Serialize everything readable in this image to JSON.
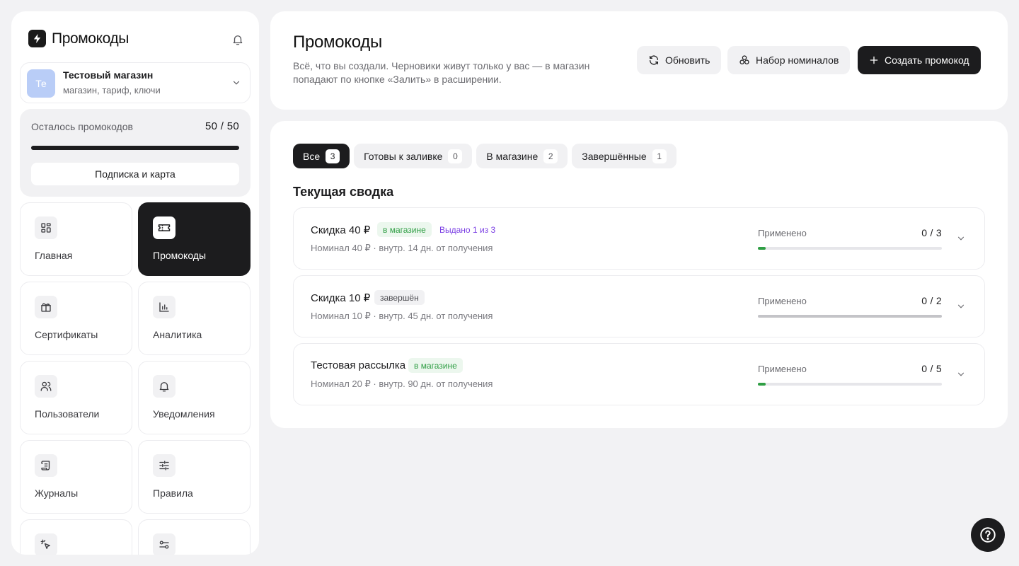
{
  "brand": {
    "title": "Промокоды"
  },
  "store": {
    "avatar": "Те",
    "name": "Тестовый магазин",
    "subtitle": "магазин, тариф, ключи"
  },
  "quota": {
    "label": "Осталось промокодов",
    "value": "50 / 50",
    "fill_fraction": 1.0,
    "subscription_label": "Подписка и карта"
  },
  "nav": [
    {
      "label": "Главная",
      "icon": "grid-icon",
      "active": false
    },
    {
      "label": "Промокоды",
      "icon": "ticket-icon",
      "active": true
    },
    {
      "label": "Сертификаты",
      "icon": "gift-icon",
      "active": false
    },
    {
      "label": "Аналитика",
      "icon": "bar-chart-icon",
      "active": false
    },
    {
      "label": "Пользователи",
      "icon": "users-icon",
      "active": false
    },
    {
      "label": "Уведомления",
      "icon": "bell-icon",
      "active": false
    },
    {
      "label": "Журналы",
      "icon": "scroll-icon",
      "active": false
    },
    {
      "label": "Правила",
      "icon": "sliders-icon",
      "active": false
    },
    {
      "label": "",
      "icon": "pointer-click-icon",
      "active": false
    },
    {
      "label": "",
      "icon": "settings-toggles-icon",
      "active": false
    }
  ],
  "header": {
    "title": "Промокоды",
    "description": "Всё, что вы создали. Черновики живут только у вас — в магазин попадают по кнопке «Залить» в расширении.",
    "refresh_label": "Обновить",
    "denominations_label": "Набор номиналов",
    "create_label": "Создать промокод"
  },
  "tabs": [
    {
      "label": "Все",
      "count": "3",
      "active": true
    },
    {
      "label": "Готовы к заливке",
      "count": "0",
      "active": false
    },
    {
      "label": "В магазине",
      "count": "2",
      "active": false
    },
    {
      "label": "Завершённые",
      "count": "1",
      "active": false
    }
  ],
  "section_title": "Текущая сводка",
  "promos": [
    {
      "name": "Скидка 40 ₽",
      "badge": "в магазине",
      "badge_type": "green",
      "issued": "Выдано 1 из 3",
      "meta": "Номинал 40 ₽ · внутр. 14 дн. от получения",
      "applied_label": "Применено",
      "applied_value": "0 / 3",
      "applied_fraction": 0.0
    },
    {
      "name": "Скидка 10 ₽",
      "badge": "завершён",
      "badge_type": "gray",
      "issued": "",
      "meta": "Номинал 10 ₽ · внутр. 45 дн. от получения",
      "applied_label": "Применено",
      "applied_value": "0 / 2",
      "applied_fraction": 0.0
    },
    {
      "name": "Тестовая рассылка",
      "badge": "в магазине",
      "badge_type": "green",
      "issued": "",
      "meta": "Номинал 20 ₽ · внутр. 90 дн. от получения",
      "applied_label": "Применено",
      "applied_value": "0 / 5",
      "applied_fraction": 0.0
    }
  ],
  "colors": {
    "accent_dark": "#1c1c1e",
    "success": "#2f9e44",
    "purple": "#7b3fe4",
    "avatar_bg": "#b9cdf7"
  }
}
